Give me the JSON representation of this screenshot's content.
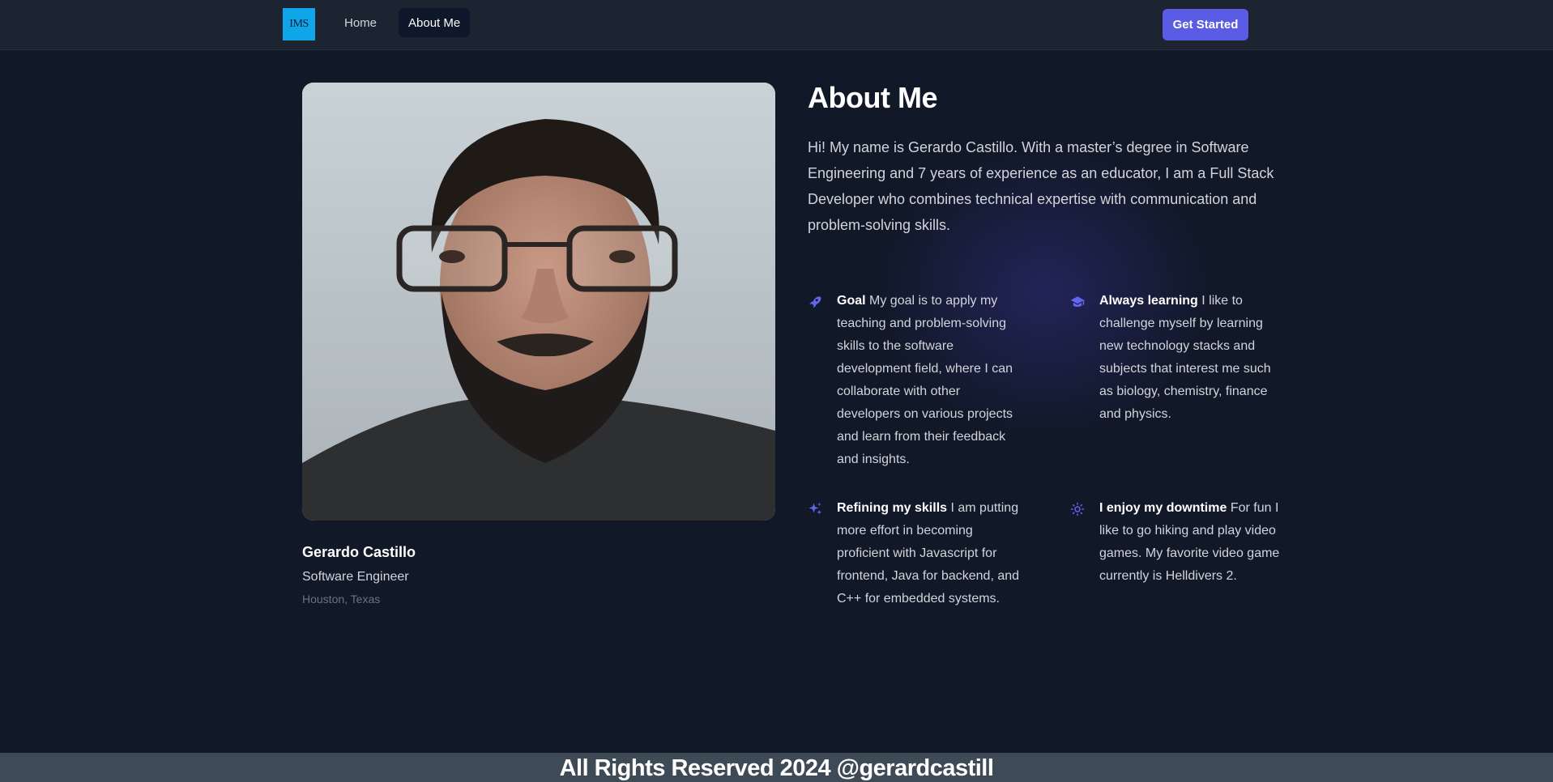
{
  "nav": {
    "logo_text": "IMS",
    "home_label": "Home",
    "about_label": "About Me",
    "cta_label": "Get Started"
  },
  "profile": {
    "name": "Gerardo Castillo",
    "role": "Software Engineer",
    "location": "Houston, Texas"
  },
  "about": {
    "title": "About Me",
    "intro": "Hi! My name is Gerardo Castillo. With a master’s degree in Software Engineering and 7 years of experience as an educator, I am a Full Stack Developer who combines technical expertise with communication and problem-solving skills."
  },
  "features": [
    {
      "title": "Goal",
      "text": "My goal is to apply my teaching and problem-solving skills to the software development field, where I can collaborate with other developers on various projects and learn from their feedback and insights.",
      "icon": "rocket-icon"
    },
    {
      "title": "Always learning",
      "text": "I like to challenge myself by learning new technology stacks and subjects that interest me such as biology, chemistry, finance and physics.",
      "icon": "graduation-cap-icon"
    },
    {
      "title": "Refining my skills",
      "text": "I am putting more effort in becoming proficient with Javascript for frontend, Java for backend, and C++ for embedded systems.",
      "icon": "sparkles-icon"
    },
    {
      "title": "I enjoy my downtime",
      "text": "For fun I like to go hiking and play video games. My favorite video game currently is Helldivers 2.",
      "icon": "sun-icon"
    }
  ],
  "footer": {
    "text": "All Rights Reserved 2024 @gerardcastill"
  },
  "colors": {
    "background": "#111827",
    "nav": "#1b2430",
    "accent": "#5b5ce6",
    "logo": "#0ea5e9",
    "footer": "#3f4a57"
  }
}
